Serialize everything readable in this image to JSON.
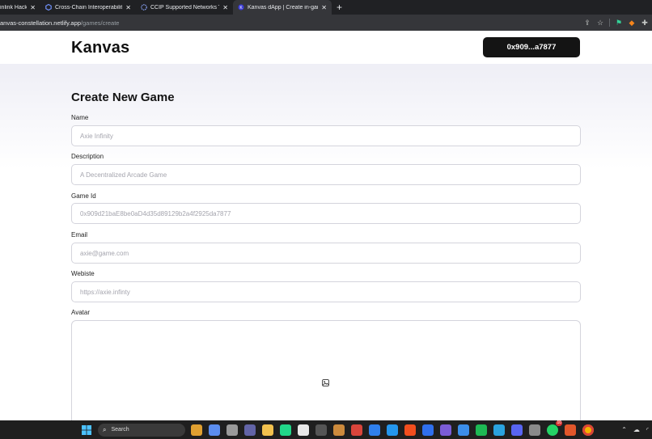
{
  "browser": {
    "tabs": [
      {
        "title": "inlink Hacka",
        "icon": "chainlink-icon",
        "color": "#375bd2"
      },
      {
        "title": "Cross-Chain Interoperability Pro",
        "icon": "chainlink-icon",
        "color": "#375bd2"
      },
      {
        "title": "CCIP Supported Networks Testn",
        "icon": "chainlink-icon",
        "color": "#375bd2"
      },
      {
        "title": "Kanvas dApp | Create in-game",
        "icon": "kanvas-icon",
        "color": "#3b3bd6"
      }
    ],
    "new_tab": "+",
    "url_host": "anvas-constellation.netlify.app",
    "url_path": "/games/create"
  },
  "header": {
    "logo": "Kanvas",
    "wallet": "0x909...a7877"
  },
  "form": {
    "title": "Create New Game",
    "fields": {
      "name": {
        "label": "Name",
        "placeholder": "Axie Infinity",
        "value": ""
      },
      "description": {
        "label": "Description",
        "placeholder": "A Decentralized Arcade Game",
        "value": ""
      },
      "game_id": {
        "label": "Game Id",
        "placeholder": "0x909d21baE8be0aD4d35d89129b2a4f2925da7877",
        "value": ""
      },
      "email": {
        "label": "Email",
        "placeholder": "axie@game.com",
        "value": ""
      },
      "website": {
        "label": "Webiste",
        "placeholder": "https://axie.infinty",
        "value": ""
      },
      "avatar": {
        "label": "Avatar",
        "icon": "image-upload-icon"
      }
    }
  },
  "taskbar": {
    "search": "Search",
    "apps": [
      {
        "name": "widgets-icon",
        "color": "#e0a030"
      },
      {
        "name": "copilot-icon",
        "color": "#5b8def"
      },
      {
        "name": "task-view-icon",
        "color": "#9a9a9a"
      },
      {
        "name": "teams-icon",
        "color": "#6264a7"
      },
      {
        "name": "file-explorer-icon",
        "color": "#f2c14e"
      },
      {
        "name": "pycharm-icon",
        "color": "#21d789"
      },
      {
        "name": "store-icon",
        "color": "#e8e8e8"
      },
      {
        "name": "terminal-icon",
        "color": "#555555"
      },
      {
        "name": "virtualbox-icon",
        "color": "#cc8a3c"
      },
      {
        "name": "record-icon",
        "color": "#d9453b"
      },
      {
        "name": "vscode-icon",
        "color": "#2f80ed"
      },
      {
        "name": "docker-icon",
        "color": "#2496ed"
      },
      {
        "name": "figma-icon",
        "color": "#f24e1e"
      },
      {
        "name": "minus-app-icon",
        "color": "#2f6fed"
      },
      {
        "name": "purple-app-icon",
        "color": "#7b5cd6"
      },
      {
        "name": "tasks-icon",
        "color": "#3b8eea"
      },
      {
        "name": "spotify-icon",
        "color": "#1db954"
      },
      {
        "name": "telegram-icon",
        "color": "#2aa3df"
      },
      {
        "name": "discord-icon",
        "color": "#5865f2"
      },
      {
        "name": "webcam-icon",
        "color": "#8a8a8a"
      },
      {
        "name": "whatsapp-icon",
        "color": "#25d366"
      },
      {
        "name": "brave-icon",
        "color": "#e2572b"
      },
      {
        "name": "chrome-icon",
        "color": "#f4b400"
      }
    ],
    "whatsapp_badge": "10"
  }
}
